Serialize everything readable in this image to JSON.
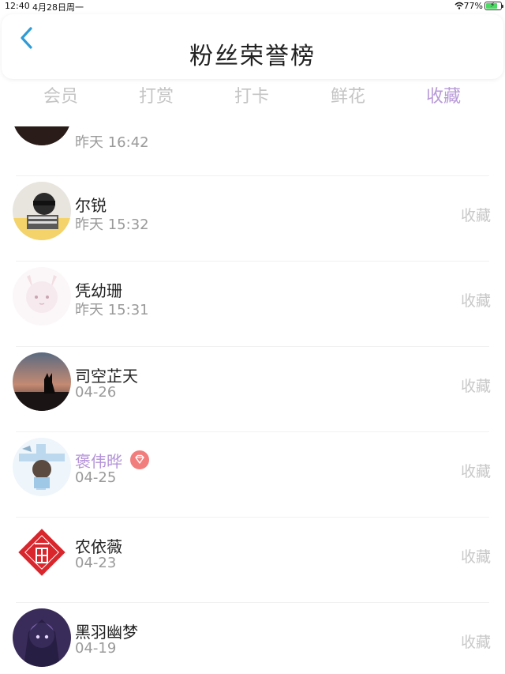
{
  "status_bar": {
    "time": "12:40",
    "date": "4月28日周一",
    "battery_percent_text": "77%",
    "battery_level": 0.77,
    "wifi_icon": "wifi-icon",
    "battery_icon": "battery-charging-icon"
  },
  "nav": {
    "back_icon": "chevron-left-icon",
    "title": "粉丝荣誉榜",
    "accent_color": "#2f9bd6"
  },
  "tabs": [
    {
      "label": "会员",
      "active": false
    },
    {
      "label": "打赏",
      "active": false
    },
    {
      "label": "打卡",
      "active": false
    },
    {
      "label": "鲜花",
      "active": false
    },
    {
      "label": "收藏",
      "active": true
    }
  ],
  "colors": {
    "active_tab": "#b89ad8",
    "inactive_tab": "#c4c4c4",
    "vip_name": "#b493d8",
    "vip_badge": "#f27d7d"
  },
  "list": {
    "items": [
      {
        "name": "",
        "time": "昨天 16:42",
        "action": ""
      },
      {
        "name": "尔锐",
        "time": "昨天 15:32",
        "action": "收藏"
      },
      {
        "name": "凭幼珊",
        "time": "昨天 15:31",
        "action": "收藏"
      },
      {
        "name": "司空芷天",
        "time": "04-26",
        "action": "收藏"
      },
      {
        "name": "褒伟晔",
        "time": "04-25",
        "action": "收藏",
        "vip": true,
        "badge_icon": "diamond-icon"
      },
      {
        "name": "农依薇",
        "time": "04-23",
        "action": "收藏"
      },
      {
        "name": "黑羽幽梦",
        "time": "04-19",
        "action": "收藏"
      }
    ]
  }
}
